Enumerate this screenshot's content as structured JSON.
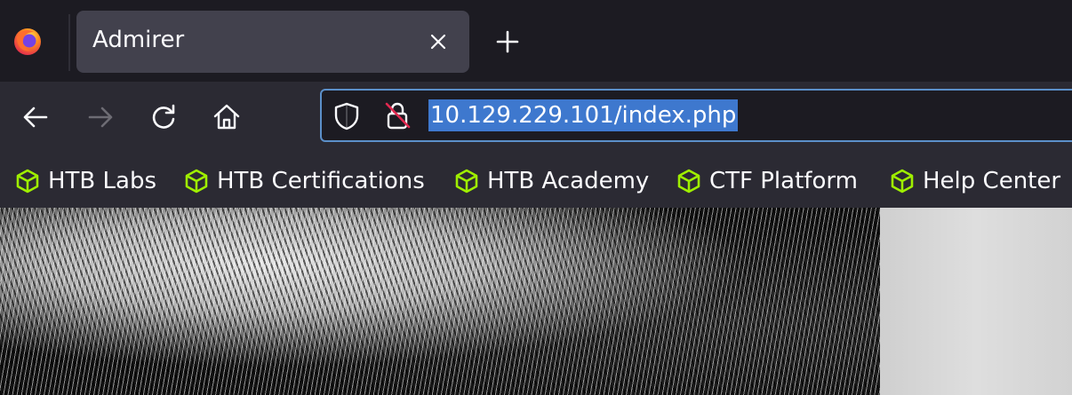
{
  "browser": {
    "tab": {
      "title": "Admirer"
    },
    "url": "10.129.229.101/index.php",
    "bookmarks": [
      {
        "label": "HTB Labs"
      },
      {
        "label": "HTB Certifications"
      },
      {
        "label": "HTB Academy"
      },
      {
        "label": "CTF Platform"
      },
      {
        "label": "Help Center"
      }
    ]
  },
  "icons": {
    "app": "firefox-icon",
    "tab_close": "close-icon",
    "new_tab": "plus-icon",
    "back": "arrow-left-icon",
    "forward": "arrow-right-icon",
    "reload": "reload-icon",
    "home": "home-icon",
    "tracking": "shield-icon",
    "security": "insecure-lock-icon",
    "bookmark": "cube-icon"
  },
  "colors": {
    "bookmark_icon": "#9fef00",
    "url_selection": "#3e78ce",
    "urlbar_focus_border": "#5b8fc9"
  }
}
